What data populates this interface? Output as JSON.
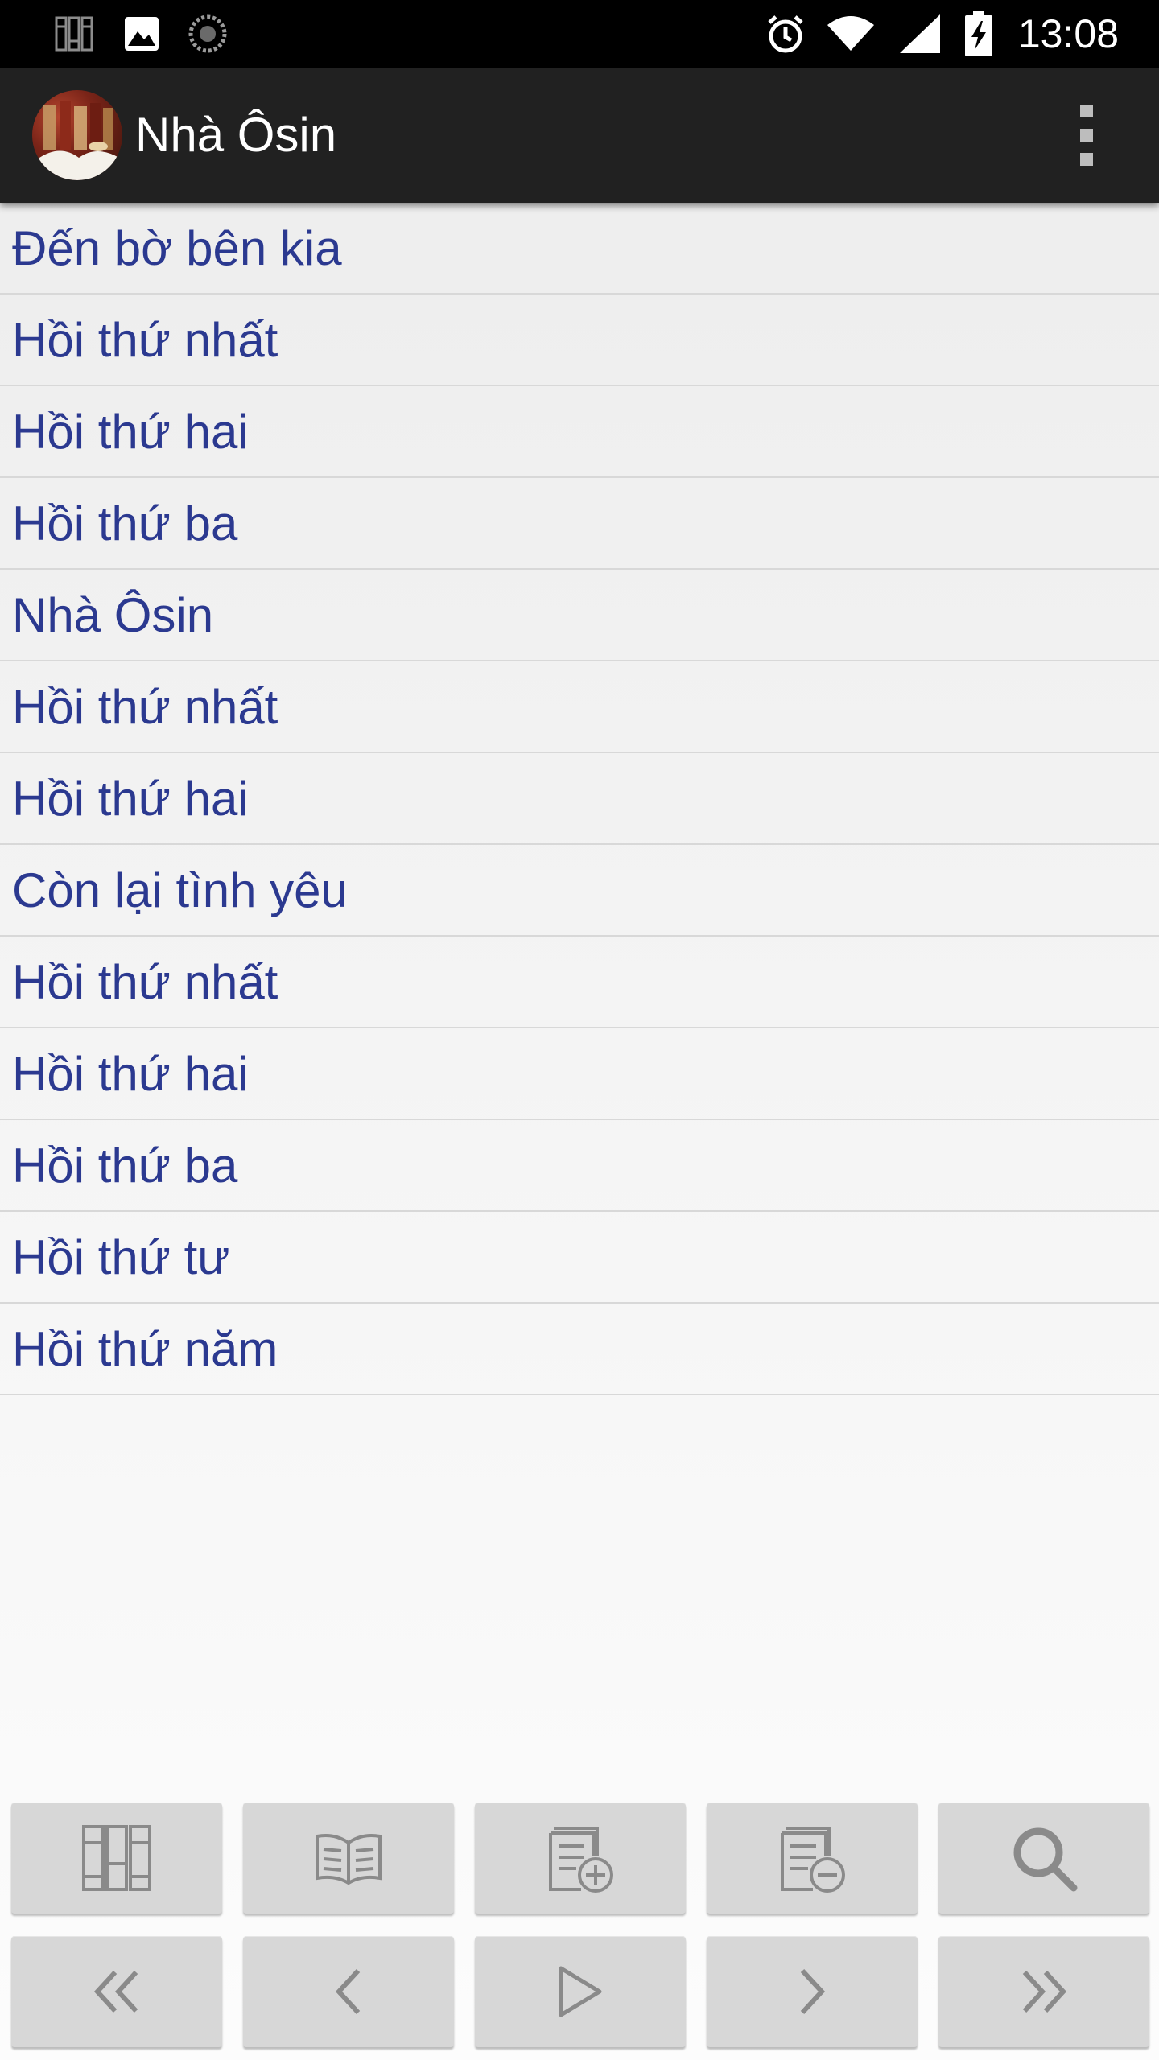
{
  "status_bar": {
    "time": "13:08",
    "icons": [
      "books-notification-icon",
      "image-notification-icon",
      "sync-notification-icon",
      "alarm-icon",
      "wifi-icon",
      "signal-icon",
      "battery-charging-icon"
    ]
  },
  "app_bar": {
    "title": "Nhà Ôsin",
    "logo_icon": "book-logo-icon",
    "menu_icon": "overflow-menu-icon"
  },
  "chapters": [
    "Đến bờ bên kia",
    "Hồi thứ nhất",
    "Hồi thứ hai",
    "Hồi thứ ba",
    "Nhà Ôsin",
    "Hồi thứ nhất",
    "Hồi thứ hai",
    "Còn lại tình yêu",
    "Hồi thứ nhất",
    "Hồi thứ hai",
    "Hồi thứ ba",
    "Hồi thứ tư",
    "Hồi thứ năm"
  ],
  "colors": {
    "chapter_text": "#2b3990",
    "app_bar": "#212121",
    "button_face": "#d7d7d7",
    "icon": "#8a8a8a"
  },
  "toolbar_top": [
    "library-icon",
    "open-book-icon",
    "add-bookmark-icon",
    "remove-bookmark-icon",
    "search-icon"
  ],
  "toolbar_bottom": [
    "first-chapter-icon",
    "previous-icon",
    "play-icon",
    "next-icon",
    "last-chapter-icon"
  ]
}
